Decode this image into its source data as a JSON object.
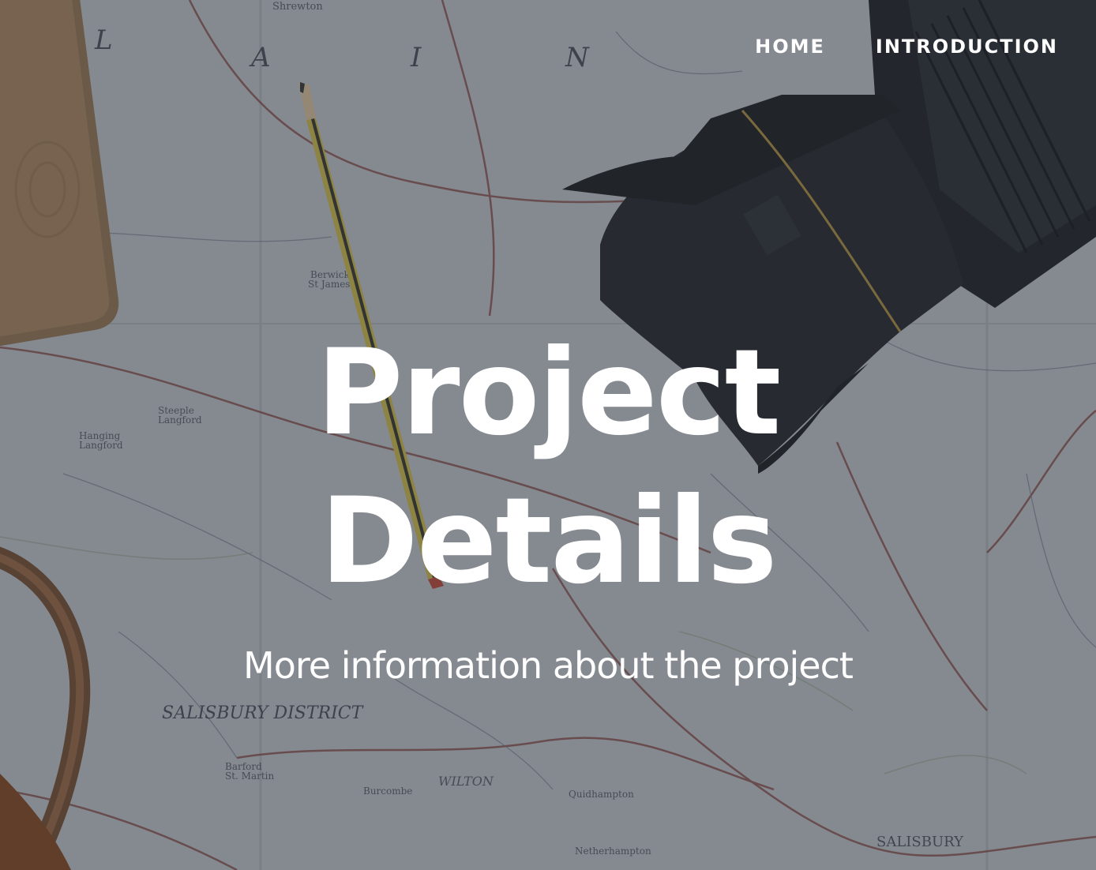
{
  "nav": {
    "items": [
      {
        "label": "HOME"
      },
      {
        "label": "INTRODUCTION"
      }
    ]
  },
  "hero": {
    "title_line1": "Project",
    "title_line2": "Details",
    "subtitle": "More information about the project"
  },
  "colors": {
    "overlay": "#2a2f38",
    "text": "#ffffff"
  }
}
